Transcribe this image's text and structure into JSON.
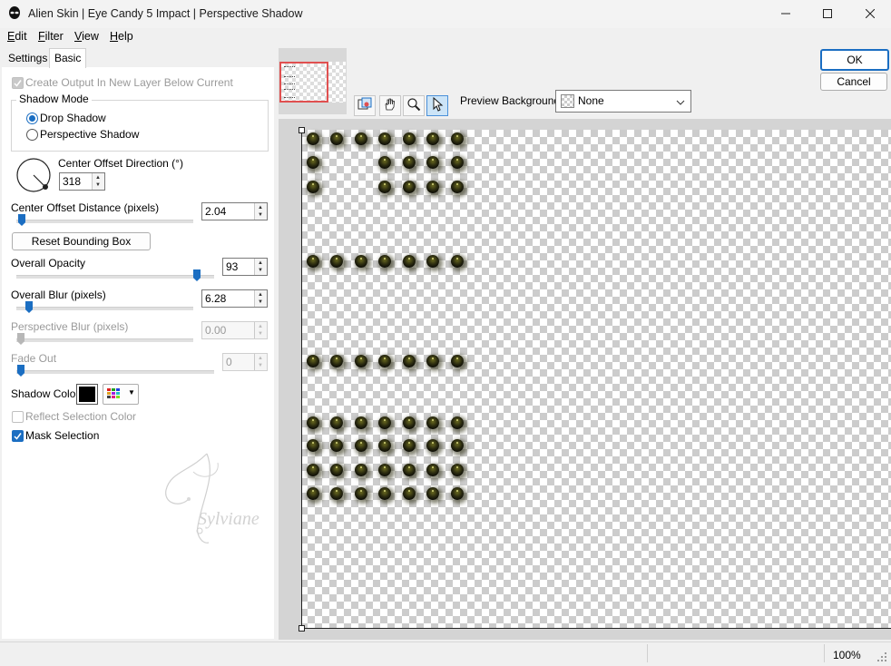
{
  "window": {
    "title": "Alien Skin | Eye Candy 5 Impact | Perspective Shadow",
    "minimize_icon": "minimize-icon",
    "maximize_icon": "maximize-icon",
    "close_icon": "close-icon"
  },
  "menu": [
    {
      "label": "Edit",
      "underline": "E",
      "rest": "dit"
    },
    {
      "label": "Filter",
      "underline": "F",
      "rest": "ilter"
    },
    {
      "label": "View",
      "underline": "V",
      "rest": "iew"
    },
    {
      "label": "Help",
      "underline": "H",
      "rest": "elp"
    }
  ],
  "tabs": {
    "settings": "Settings",
    "basic": "Basic"
  },
  "basic": {
    "create_output": "Create Output In New Layer Below Current",
    "shadow_mode_title": "Shadow Mode",
    "drop_shadow": "Drop Shadow",
    "perspective_shadow": "Perspective Shadow",
    "selected_mode": "Drop Shadow",
    "direction_label": "Center Offset Direction (°)",
    "direction_value": "318",
    "distance_label": "Center Offset Distance (pixels)",
    "distance_value": "2.04",
    "reset_bounding_box": "Reset Bounding Box",
    "opacity_label": "Overall Opacity",
    "opacity_value": "93",
    "blur_label": "Overall Blur (pixels)",
    "blur_value": "6.28",
    "perspective_blur_label": "Perspective Blur (pixels)",
    "perspective_blur_value": "0.00",
    "fade_out_label": "Fade Out",
    "fade_out_value": "0",
    "shadow_color_label": "Shadow Color",
    "shadow_color": "#000000",
    "reflect_selection_color": "Reflect Selection Color",
    "mask_selection": "Mask Selection",
    "watermark_text": "Sylviane"
  },
  "preview": {
    "background_label": "Preview Background:",
    "background_value": "None",
    "tools": [
      "hand-split-icon",
      "hand-icon",
      "zoom-icon",
      "arrow-icon"
    ]
  },
  "buttons": {
    "ok": "OK",
    "cancel": "Cancel"
  },
  "status": {
    "zoom": "100%"
  }
}
